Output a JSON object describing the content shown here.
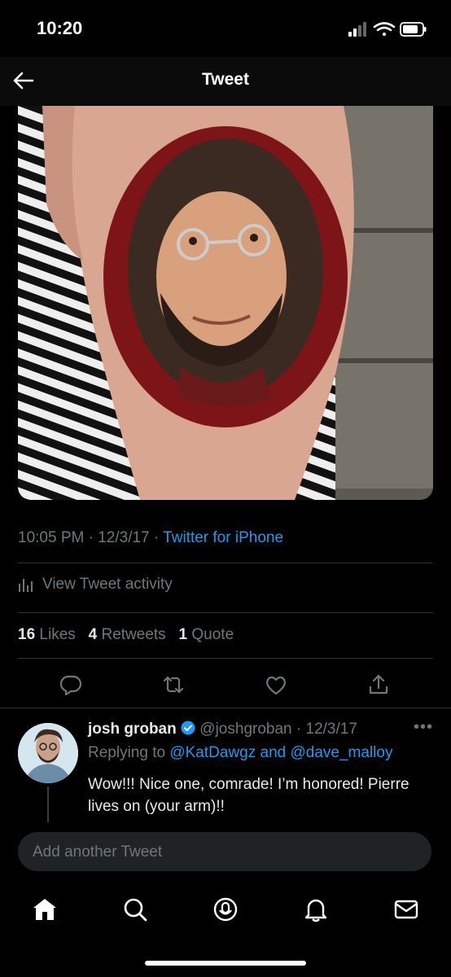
{
  "status_bar": {
    "time": "10:20"
  },
  "header": {
    "title": "Tweet"
  },
  "tweet": {
    "meta": {
      "time": "10:05 PM",
      "date": "12/3/17",
      "source": "Twitter for iPhone"
    },
    "activity_label": "View Tweet activity",
    "stats": {
      "likes_count": "16",
      "likes_label": "Likes",
      "retweets_count": "4",
      "retweets_label": "Retweets",
      "quotes_count": "1",
      "quotes_label": "Quote"
    }
  },
  "reply": {
    "name": "josh groban",
    "handle": "@joshgroban",
    "date": "12/3/17",
    "replying_prefix": "Replying to",
    "mention_1": "@KatDawgz",
    "and_word": "and",
    "mention_2": "@dave_malloy",
    "text": "Wow!!! Nice one, comrade! I’m honored! Pierre lives on (your arm)!!"
  },
  "composer": {
    "placeholder": "Add another Tweet"
  },
  "colors": {
    "accent": "#1d9bf0",
    "background": "#000000",
    "muted": "#71767b"
  }
}
